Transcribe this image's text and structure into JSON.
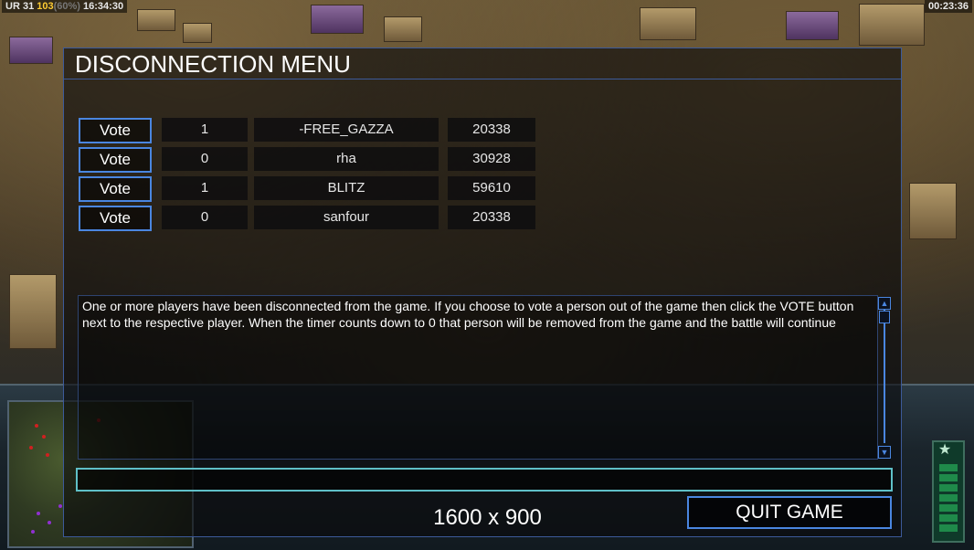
{
  "hud": {
    "top_left_prefix": "UR",
    "top_left_a": "31",
    "top_left_b": "103",
    "top_left_c": "(60%)",
    "top_left_time": "16:34:30",
    "top_right_time": "00:23:36"
  },
  "dialog": {
    "title": "DISCONNECTION MENU",
    "vote_label": "Vote",
    "players": [
      {
        "votes": "1",
        "name": "-FREE_GAZZA",
        "ping": "20338"
      },
      {
        "votes": "0",
        "name": "rha",
        "ping": "30928"
      },
      {
        "votes": "1",
        "name": "BLITZ",
        "ping": "59610"
      },
      {
        "votes": "0",
        "name": "sanfour",
        "ping": "20338"
      }
    ],
    "message": "One or more players have been disconnected from the game. If you choose to vote a person out of the game then click the VOTE button next to the respective player. When the timer counts down to 0 that person will be removed from the game and the battle will continue",
    "quit_label": "QUIT GAME",
    "resolution_label": "1600 x 900"
  },
  "colors": {
    "accent": "#4a86e0",
    "chat_border": "#5fc0c8"
  }
}
